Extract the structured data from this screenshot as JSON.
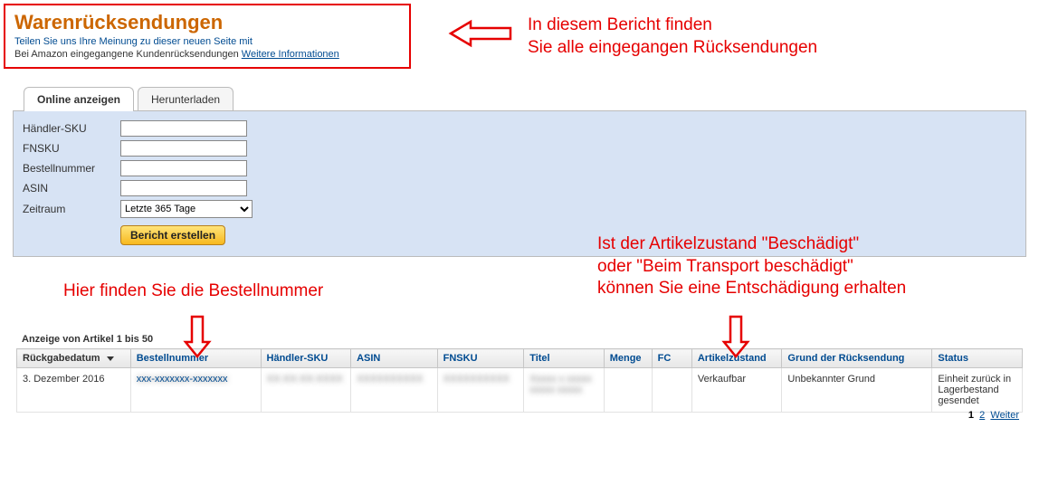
{
  "header": {
    "title": "Warenrücksendungen",
    "feedback": "Teilen Sie uns Ihre Meinung zu dieser neuen Seite mit",
    "subtext": "Bei Amazon eingegangene Kundenrücksendungen ",
    "link": "Weitere Informationen"
  },
  "annotations": {
    "top1": "In diesem Bericht finden",
    "top2": "Sie alle eingegangen Rücksendungen",
    "mid": "Hier finden Sie die Bestellnummer",
    "right1": "Ist der Artikelzustand \"Beschädigt\"",
    "right2": "oder \"Beim Transport beschädigt\"",
    "right3": "können Sie eine Entschädigung erhalten"
  },
  "tabs": {
    "active": "Online anzeigen",
    "inactive": "Herunterladen"
  },
  "filters": {
    "sku_label": "Händler-SKU",
    "fnsku_label": "FNSKU",
    "order_label": "Bestellnummer",
    "asin_label": "ASIN",
    "period_label": "Zeitraum",
    "period_value": "Letzte 365 Tage",
    "button": "Bericht erstellen"
  },
  "results": {
    "summary": "Anzeige von Artikel 1 bis 50",
    "pagination": {
      "current": "1",
      "next": "2",
      "more": "Weiter"
    },
    "columns": {
      "date": "Rückgabedatum",
      "order": "Bestellnummer",
      "sku": "Händler-SKU",
      "asin": "ASIN",
      "fnsku": "FNSKU",
      "title": "Titel",
      "qty": "Menge",
      "fc": "FC",
      "condition": "Artikelzustand",
      "reason": "Grund der Rücksendung",
      "status": "Status"
    },
    "rows": [
      {
        "date": "3. Dezember 2016",
        "order": "xxx-xxxxxxx-xxxxxxx",
        "sku": "XX-XX-XX-XXXX",
        "asin": "XXXXXXXXXX",
        "fnsku": "XXXXXXXXXX",
        "title": "Xxxxx x xxxxx xxxxx xxxxx",
        "qty": "",
        "fc": "",
        "condition": "Verkaufbar",
        "reason": "Unbekannter Grund",
        "status": "Einheit zurück in Lagerbestand gesendet"
      }
    ]
  }
}
